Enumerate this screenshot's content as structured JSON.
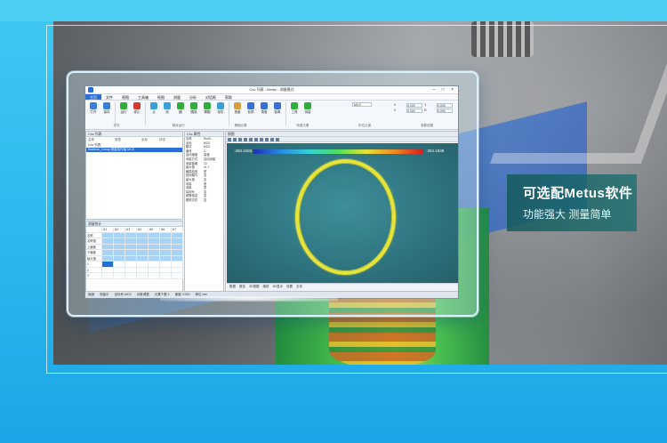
{
  "promo": {
    "headline": "可选配Metus软件",
    "subline": "功能强大 测量简单"
  },
  "app": {
    "title": "Cnc 列表 - Metus - 测量模式",
    "window_buttons": "– □ ×",
    "menu": [
      "主页",
      "文件",
      "视图",
      "工具箱",
      "绘图",
      "测量",
      "分析",
      "对话框",
      "帮助"
    ],
    "ribbon_buttons": [
      {
        "label": "打开",
        "color": "#3b7fd8"
      },
      {
        "label": "保存",
        "color": "#3b7fd8"
      },
      {
        "label": "运行",
        "color": "#2fae3a"
      },
      {
        "label": "停止",
        "color": "#d43a2f"
      },
      {
        "label": "点",
        "color": "#3aa0d8"
      },
      {
        "label": "线",
        "color": "#3aa0d8"
      },
      {
        "label": "圆",
        "color": "#2fae3a"
      },
      {
        "label": "圆弧",
        "color": "#2fae3a"
      },
      {
        "label": "椭圆",
        "color": "#2fae3a"
      },
      {
        "label": "矩形",
        "color": "#3aa0d8"
      },
      {
        "label": "宽度",
        "color": "#d8a03a"
      },
      {
        "label": "轮廓",
        "color": "#3a6fd8"
      },
      {
        "label": "角度",
        "color": "#3a6fd8"
      },
      {
        "label": "距离",
        "color": "#3a6fd8"
      },
      {
        "label": "工具",
        "color": "#2fae3a"
      },
      {
        "label": "测量",
        "color": "#2fae3a"
      }
    ],
    "ribbon_groups": [
      "文件",
      "程序运行",
      "基础元素",
      "构造元素",
      "形位公差",
      "参数设置"
    ],
    "combo_value": "MCS",
    "inputs": {
      "labels": [
        "X",
        "Y",
        "Z",
        "R"
      ],
      "values": [
        "0.000",
        "0.000",
        "0.000",
        "0.000"
      ]
    },
    "tree": {
      "title": "Cnc 列表",
      "headers": [
        "名称",
        "类型",
        "坐标",
        "状态"
      ],
      "rows": [
        {
          "text": "Cnc 列表",
          "selected": false
        },
        {
          "text": "Runtime_Group  测量执行组  MCS",
          "selected": true
        }
      ]
    },
    "props": {
      "title": "Cnc 属性",
      "rows": [
        [
          "名称",
          "Runti..."
        ],
        [
          "坐标",
          "MCS"
        ],
        [
          "模式",
          "MCS"
        ],
        [
          "编号",
          "0"
        ],
        [
          "运动速度",
          "高速"
        ],
        [
          "测量方式",
          "自动测量"
        ],
        [
          "测量距离",
          "10"
        ],
        [
          "最大值",
          "41.7"
        ],
        [
          "触摸检测",
          "是"
        ],
        [
          "检测模式",
          "否"
        ],
        [
          "最大值",
          "否"
        ],
        [
          "测量",
          "是"
        ],
        [
          "测量",
          "是"
        ],
        [
          "探测头",
          "否"
        ],
        [
          "报警信息",
          "否"
        ],
        [
          "跟踪文件",
          "否"
        ]
      ]
    },
    "measure": {
      "title": "测量统计",
      "headers": [
        "",
        "A1",
        "A2",
        "A3",
        "A4",
        "A5",
        "A6",
        "A7"
      ],
      "rows": [
        "名称",
        "名称值",
        "上偏差",
        "下偏差",
        "最大值",
        "1",
        "2",
        "3"
      ]
    },
    "view": {
      "title": "视图",
      "scale_min": "-260.2283",
      "scale_max": "-254.1939",
      "tabs": [
        "数据",
        "报告",
        "3D视图",
        "缩放",
        "3D显示",
        "设置",
        "文本"
      ]
    },
    "status": [
      "就绪",
      "测量中",
      "坐标系 MCS",
      "对象调整",
      "元素个数 1",
      "速度 0.000",
      "单位 mm"
    ]
  }
}
